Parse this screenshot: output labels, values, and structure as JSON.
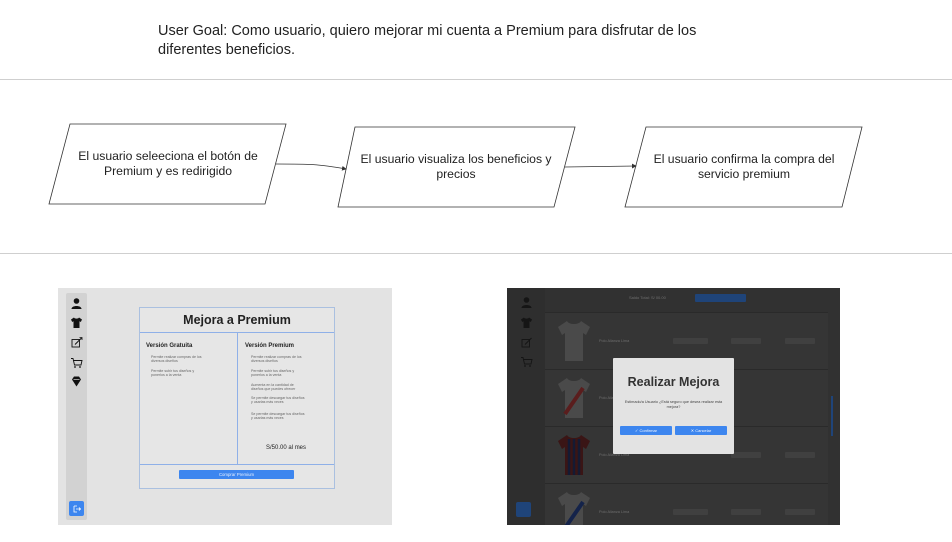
{
  "user_goal": "User Goal:  Como usuario, quiero mejorar mi cuenta a Premium para disfrutar de los diferentes beneficios.",
  "flow": {
    "steps": [
      {
        "id": "s1",
        "label": "El usuario seleeciona el botón de Premium y es redirigido"
      },
      {
        "id": "s2",
        "label": "El usuario visualiza los beneficios y precios"
      },
      {
        "id": "s3",
        "label": "El usuario confirma la compra del servicio premium"
      }
    ],
    "edges": [
      {
        "from": "s1",
        "to": "s2"
      },
      {
        "from": "s2",
        "to": "s3"
      }
    ]
  },
  "mockup_premium": {
    "sidebar_icons": [
      "user-icon",
      "shirt-icon",
      "design-icon",
      "cart-icon",
      "premium-icon"
    ],
    "logout_icon": "logout-icon",
    "title": "Mejora a Premium",
    "free": {
      "heading": "Versión Gratuita",
      "features": [
        "Permite realizar compras de los diversos diseños",
        "Permite subir tus diseños y ponerlos a la venta"
      ]
    },
    "premium": {
      "heading": "Versión Premium",
      "features": [
        "Permite realizar compras de los diversos diseños",
        "Permite subir tus diseños y ponerlos a la venta",
        "Aumenta en la cantidad de diseños que puedes ofrecer",
        "Se permite descargar tus diseños y usarlas más veces",
        "Se permite descargar tus diseños y usarlas más veces"
      ],
      "price": "S/50.00 al mes"
    },
    "buy_button": "Comprar Premium"
  },
  "mockup_confirm": {
    "top_label": "Saldo Total: S/ 00.00",
    "row_label": "Polo Alianza Lima",
    "modal": {
      "title": "Realizar Mejora",
      "text": "Estimado/a Usuario ¿Está seguro que desea realizar esta mejora?",
      "confirm": "Confirmar",
      "cancel": "Cancelar"
    }
  },
  "colors": {
    "accent": "#3d86ef",
    "line": "#333333",
    "divider": "#cfcfcf"
  }
}
